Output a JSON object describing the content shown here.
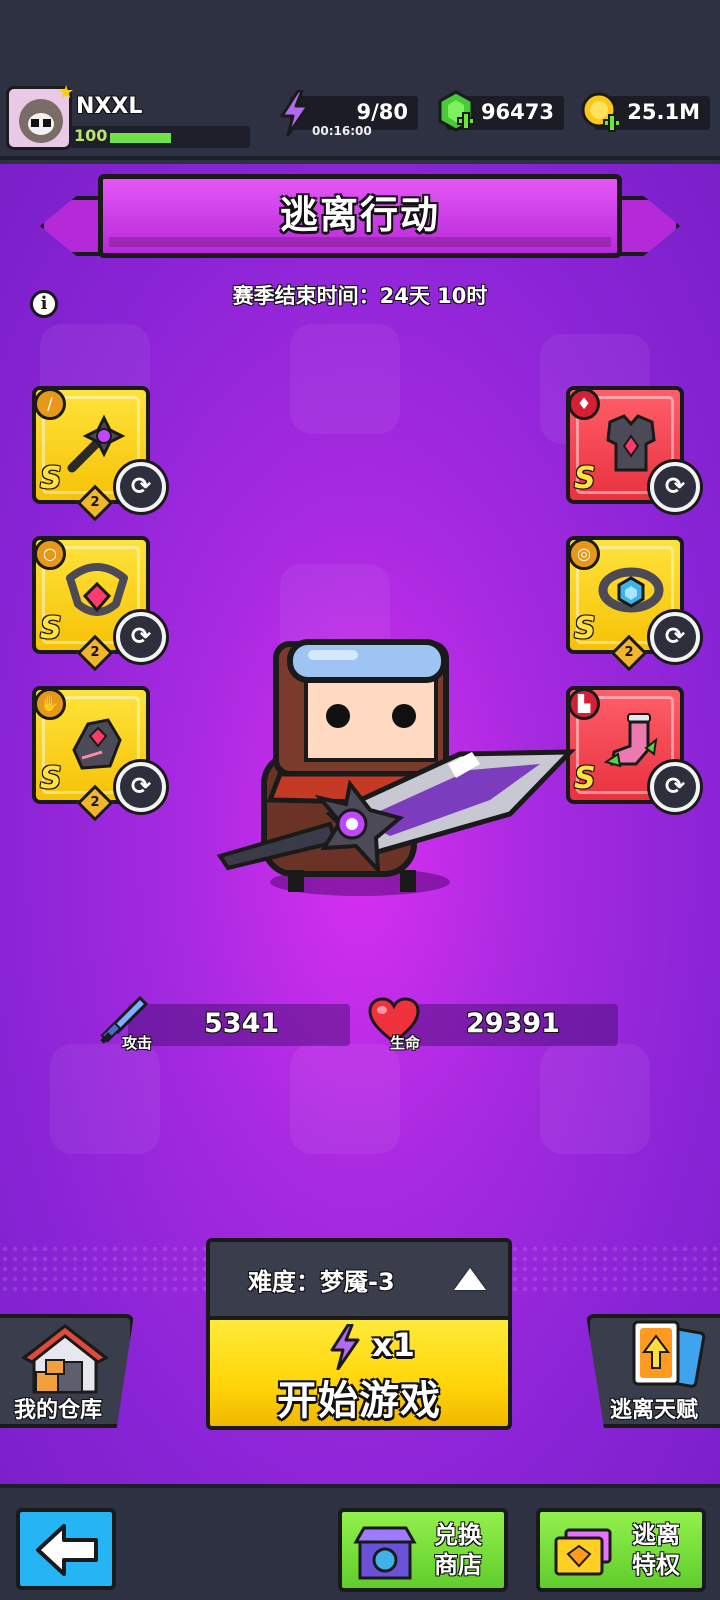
{
  "player": {
    "name": "NXXL",
    "level": "100",
    "xp_fraction": 0.45
  },
  "resources": {
    "energy": "9/80",
    "energy_timer": "00:16:00",
    "gems": "96473",
    "coins": "25.1M"
  },
  "title": "逃离行动",
  "season": "赛季结束时间：24天 10时",
  "equipment": {
    "left": [
      {
        "slot": "weapon",
        "grade": "S",
        "level": "2",
        "color": "yellow"
      },
      {
        "slot": "necklace",
        "grade": "S",
        "level": "2",
        "color": "yellow"
      },
      {
        "slot": "gloves",
        "grade": "S",
        "level": "2",
        "color": "yellow"
      }
    ],
    "right": [
      {
        "slot": "armor",
        "grade": "S",
        "color": "red"
      },
      {
        "slot": "belt",
        "grade": "S",
        "level": "2",
        "color": "yellow"
      },
      {
        "slot": "boots",
        "grade": "S",
        "color": "red"
      }
    ]
  },
  "stats": {
    "attack_label": "攻击",
    "attack": "5341",
    "hp_label": "生命",
    "hp": "29391"
  },
  "difficulty": "难度：梦魇-3",
  "start": {
    "cost": "x1",
    "label": "开始游戏"
  },
  "warehouse_label": "我的仓库",
  "talent_label": "逃离天赋",
  "nav": {
    "shop_label": "兑换商店",
    "privilege_label": "逃离特权"
  },
  "colors": {
    "bg_dark": "#2d3142",
    "purple": "#a72ae0",
    "banner": "#d44ef0",
    "yellow_slot": "#ffd60a",
    "red_slot": "#e9323f",
    "green_btn": "#7fe23e",
    "blue_btn": "#26b5f4"
  },
  "icons": [
    "energy-icon",
    "gem-icon",
    "coin-icon",
    "info-icon",
    "swap-icon",
    "sword-icon",
    "heart-icon",
    "house-icon",
    "talent-card-icon",
    "shop-icon",
    "privilege-icon",
    "back-arrow-icon"
  ]
}
